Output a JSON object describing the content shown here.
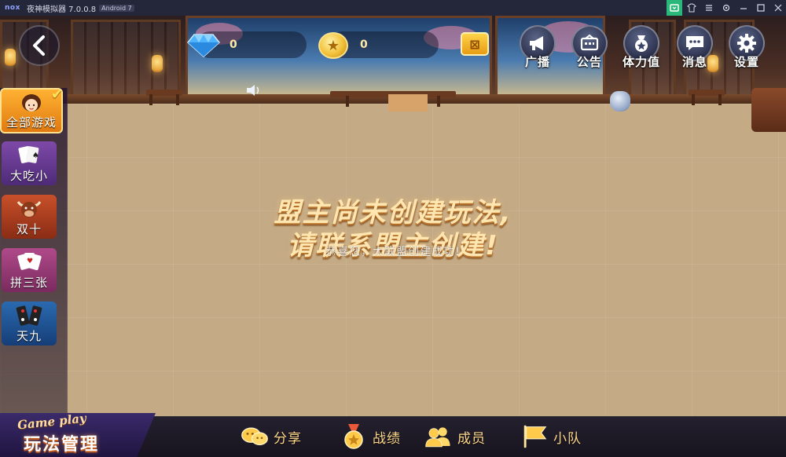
{
  "emulator": {
    "logo": "nox",
    "title": "夜神模拟器 7.0.0.8",
    "android_badge": "Android 7",
    "controls": [
      "app-store-icon",
      "shirt-icon",
      "menu-icon",
      "settings-icon",
      "minimize-icon",
      "maximize-icon",
      "close-icon"
    ]
  },
  "hud": {
    "diamonds": "0",
    "coins": "0",
    "buttons": [
      {
        "id": "broadcast",
        "label": "广播",
        "icon": "megaphone-icon"
      },
      {
        "id": "announcement",
        "label": "公告",
        "icon": "notice-board-icon"
      },
      {
        "id": "stamina",
        "label": "体力值",
        "icon": "stamina-icon"
      },
      {
        "id": "messages",
        "label": "消息",
        "icon": "chat-bubble-icon"
      },
      {
        "id": "settings",
        "label": "设置",
        "icon": "gear-icon"
      }
    ]
  },
  "sidebar": {
    "items": [
      {
        "label": "全部游戏",
        "selected": true
      },
      {
        "label": "大吃小",
        "selected": false
      },
      {
        "label": "双十",
        "selected": false
      },
      {
        "label": "拼三张",
        "selected": false
      },
      {
        "label": "天九",
        "selected": false
      }
    ]
  },
  "message": {
    "line1": "盟主尚未创建玩法,",
    "line2": "请联系盟主创建!",
    "toast": "恭喜您，大联盟创建成功!"
  },
  "bottom": {
    "banner_en": "Game play",
    "banner_cn": "玩法管理",
    "tabs": [
      {
        "label": "分享",
        "icon": "share-chat-icon"
      },
      {
        "label": "战绩",
        "icon": "medal-icon"
      },
      {
        "label": "成员",
        "icon": "members-icon"
      },
      {
        "label": "小队",
        "icon": "flag-icon"
      }
    ]
  },
  "colors": {
    "accent_gold": "#ffd98c",
    "selected_tab": "#f0951e",
    "emulator_active": "#2ab77a"
  }
}
